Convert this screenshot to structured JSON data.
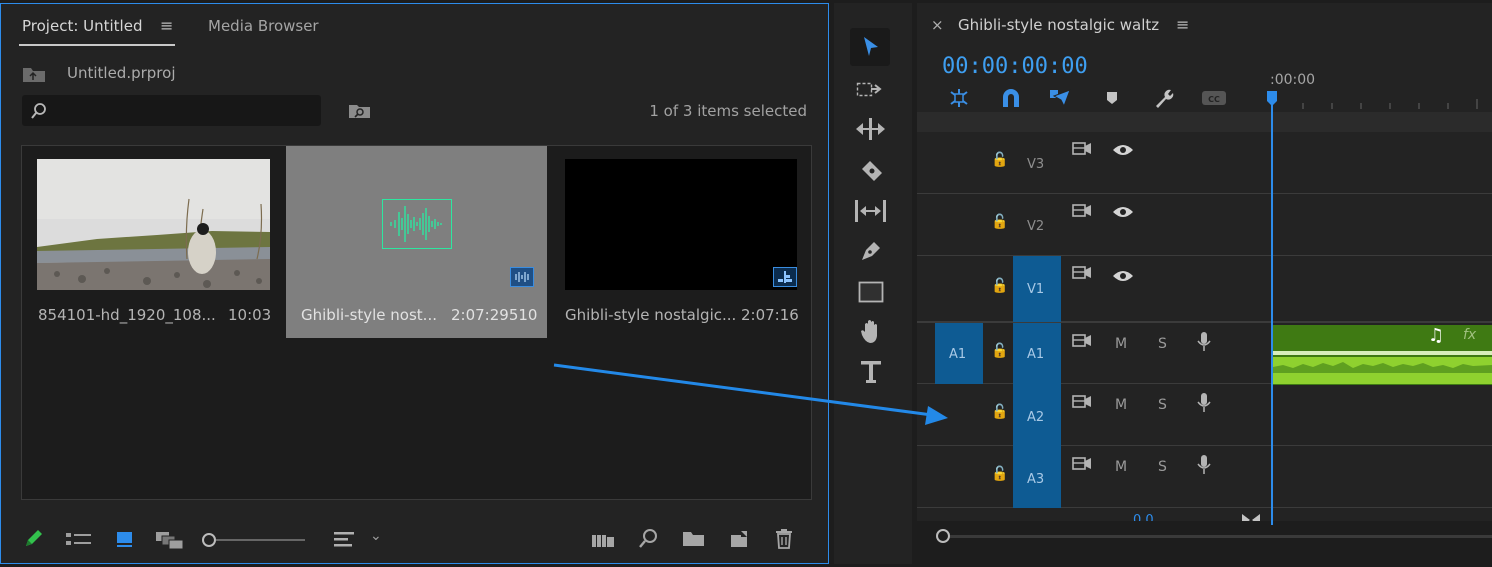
{
  "project_panel": {
    "tab_project": "Project: Untitled",
    "tab_media_browser": "Media Browser",
    "file_name": "Untitled.prproj",
    "search_placeholder": "",
    "selection_status": "1 of 3 items selected",
    "items": [
      {
        "name": "854101-hd_1920_108...",
        "duration": "10:03"
      },
      {
        "name": "Ghibli-style nost...",
        "duration": "2:07:29510"
      },
      {
        "name": "Ghibli-style nostalgic...",
        "duration": "2:07:16"
      }
    ]
  },
  "timeline": {
    "sequence_name": "Ghibli-style nostalgic waltz",
    "timecode": "00:00:00:00",
    "ruler_start": ":00:00",
    "bottom_value": "0.0",
    "tracks": [
      {
        "id": "V3",
        "target": ""
      },
      {
        "id": "V2",
        "target": ""
      },
      {
        "id": "V1",
        "target": ""
      },
      {
        "id": "A1",
        "target": "A1",
        "m": "M",
        "s": "S"
      },
      {
        "id": "A2",
        "target": "",
        "m": "M",
        "s": "S"
      },
      {
        "id": "A3",
        "target": "",
        "m": "M",
        "s": "S"
      }
    ]
  },
  "colors": {
    "accent": "#2d8ceb",
    "audio_clip": "#3f7a13",
    "waveform": "#8fd12f",
    "track_target": "#0e5b93",
    "timecode": "#3e9ef0"
  },
  "icons": [
    "pencil-icon",
    "list-view-icon",
    "icon-view-icon",
    "freeform-view-icon",
    "zoom-slider",
    "sort-icon",
    "automate-icon",
    "find-icon",
    "new-bin-icon",
    "new-item-icon",
    "trash-icon",
    "selection-tool-icon",
    "track-select-icon",
    "ripple-edit-icon",
    "razor-icon",
    "slip-icon",
    "pen-icon",
    "rectangle-icon",
    "hand-icon",
    "type-icon"
  ]
}
